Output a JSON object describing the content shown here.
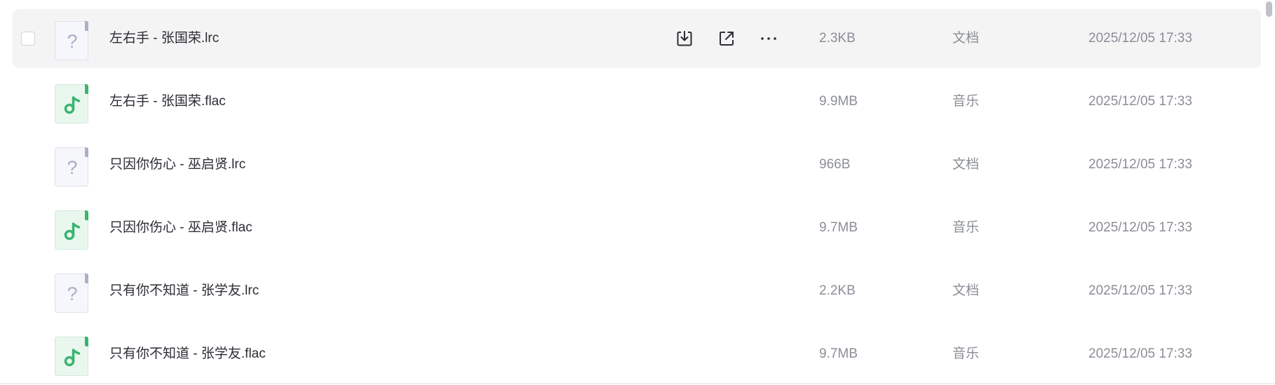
{
  "files": [
    {
      "name": "左右手 - 张国荣.lrc",
      "size": "2.3KB",
      "type": "文档",
      "date": "2025/12/05 17:33",
      "icon": "unknown-file-icon",
      "hovered": true
    },
    {
      "name": "左右手 - 张国荣.flac",
      "size": "9.9MB",
      "type": "音乐",
      "date": "2025/12/05 17:33",
      "icon": "music-file-icon",
      "hovered": false
    },
    {
      "name": "只因你伤心 - 巫启贤.lrc",
      "size": "966B",
      "type": "文档",
      "date": "2025/12/05 17:33",
      "icon": "unknown-file-icon",
      "hovered": false
    },
    {
      "name": "只因你伤心 - 巫启贤.flac",
      "size": "9.7MB",
      "type": "音乐",
      "date": "2025/12/05 17:33",
      "icon": "music-file-icon",
      "hovered": false
    },
    {
      "name": "只有你不知道 - 张学友.lrc",
      "size": "2.2KB",
      "type": "文档",
      "date": "2025/12/05 17:33",
      "icon": "unknown-file-icon",
      "hovered": false
    },
    {
      "name": "只有你不知道 - 张学友.flac",
      "size": "9.7MB",
      "type": "音乐",
      "date": "2025/12/05 17:33",
      "icon": "music-file-icon",
      "hovered": false
    }
  ],
  "row_actions": [
    "download-icon",
    "share-icon",
    "more-icon"
  ],
  "colors": {
    "hover_row": "#f4f4f5",
    "music_accent": "#39b56f",
    "doc_accent": "#a9afc6",
    "text_primary": "#2b2d33",
    "text_secondary": "#8b8e96"
  }
}
